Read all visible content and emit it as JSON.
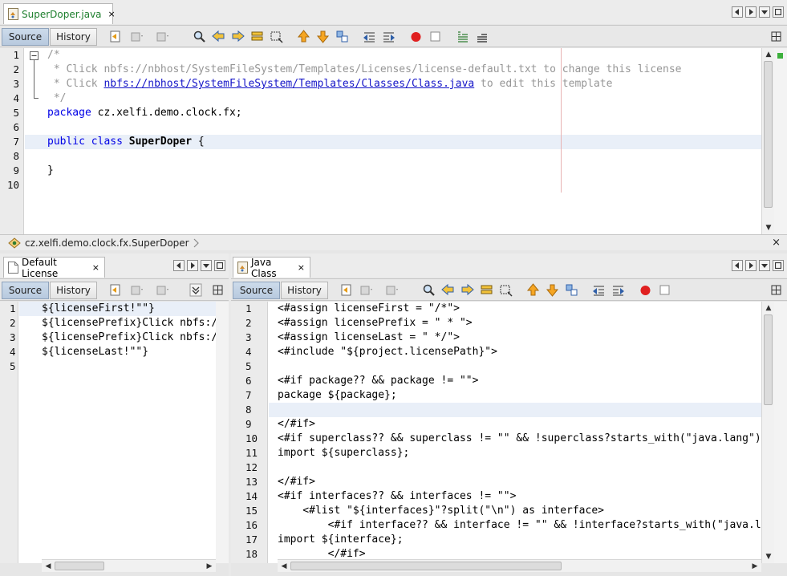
{
  "top": {
    "tab": {
      "label": "SuperDoper.java",
      "close": "×"
    },
    "source_label": "Source",
    "history_label": "History",
    "lines": [
      "1",
      "2",
      "3",
      "4",
      "5",
      "6",
      "7",
      "8",
      "9",
      "10"
    ],
    "code": {
      "l1": "/*",
      "l2": " * Click nbfs://nbhost/SystemFileSystem/Templates/Licenses/license-default.txt to change this license",
      "l3_pre": " * Click ",
      "l3_link": "nbfs://nbhost/SystemFileSystem/Templates/Classes/Class.java",
      "l3_post": " to edit this template",
      "l4": " */",
      "l5_kw": "package",
      "l5_rest": " cz.xelfi.demo.clock.fx;",
      "l7_kw": "public class",
      "l7_name": "SuperDoper",
      "l7_rest": " {",
      "l9": "}"
    },
    "breadcrumb": "cz.xelfi.demo.clock.fx.SuperDoper",
    "breadcrumb_close": "×"
  },
  "left": {
    "tab": {
      "label": "Default License",
      "close": "×"
    },
    "source_label": "Source",
    "history_label": "History",
    "lines": [
      "1",
      "2",
      "3",
      "4",
      "5"
    ],
    "code": [
      "${licenseFirst!\"\"}",
      "${licensePrefix}Click nbfs://nbhost/SystemFileSystem/Templates/Licenses/license-default.txt",
      "${licensePrefix}Click nbfs://nbhost/SystemFileSystem/Templates/Licenses/license-default.txt",
      "${licenseLast!\"\"}",
      ""
    ]
  },
  "right": {
    "tab": {
      "label": "Java Class",
      "close": "×"
    },
    "source_label": "Source",
    "history_label": "History",
    "lines": [
      "1",
      "2",
      "3",
      "4",
      "5",
      "6",
      "7",
      "8",
      "9",
      "10",
      "11",
      "12",
      "13",
      "14",
      "15",
      "16",
      "17",
      "18"
    ],
    "code": [
      "<#assign licenseFirst = \"/*\">",
      "<#assign licensePrefix = \" * \">",
      "<#assign licenseLast = \" */\">",
      "<#include \"${project.licensePath}\">",
      "",
      "<#if package?? && package != \"\">",
      "package ${package};",
      "",
      "</#if>",
      "<#if superclass?? && superclass != \"\" && !superclass?starts_with(\"java.lang\")>",
      "import ${superclass};",
      "",
      "</#if>",
      "<#if interfaces?? && interfaces != \"\">",
      "    <#list \"${interfaces}\"?split(\"\\n\") as interface>",
      "        <#if interface?? && interface != \"\" && !interface?starts_with(\"java.lang\")>",
      "import ${interface};",
      "        </#if>"
    ]
  },
  "colors": {
    "accent_tab": "#1c7e2c",
    "keyword": "#0000e6",
    "comment": "#969696",
    "link": "#1515c8",
    "record": "#e02020"
  },
  "icons": [
    "java-file-icon",
    "document-icon",
    "last-edit-icon",
    "back-icon",
    "forward-icon",
    "find-selection-icon",
    "find-previous-icon",
    "find-next-icon",
    "toggle-highlight-icon",
    "toggle-rect-select-icon",
    "previous-bookmark-icon",
    "next-bookmark-icon",
    "toggle-bookmark-icon",
    "shift-left-icon",
    "shift-right-icon",
    "start-macro-icon",
    "stop-macro-icon",
    "comment-icon",
    "uncomment-icon"
  ]
}
